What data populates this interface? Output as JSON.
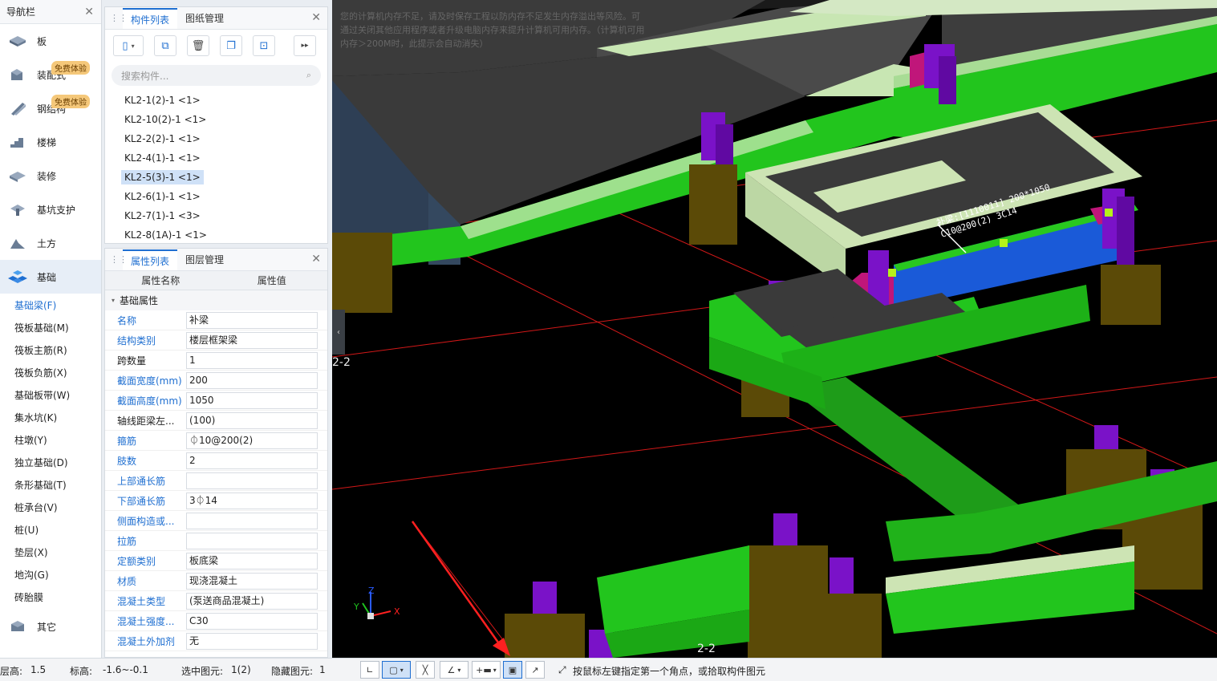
{
  "nav": {
    "title": "导航栏",
    "categories": [
      {
        "label": "板",
        "icon": "slab-icon"
      },
      {
        "label": "装配式",
        "icon": "prefab-icon",
        "badge": "免费体验"
      },
      {
        "label": "钢结构",
        "icon": "steel-structure-icon",
        "badge": "免费体验"
      },
      {
        "label": "楼梯",
        "icon": "stair-icon"
      },
      {
        "label": "装修",
        "icon": "decoration-icon"
      },
      {
        "label": "基坑支护",
        "icon": "pit-support-icon"
      },
      {
        "label": "土方",
        "icon": "earthwork-icon"
      },
      {
        "label": "基础",
        "icon": "foundation-icon"
      }
    ],
    "sub_items": [
      "基础梁(F)",
      "筏板基础(M)",
      "筏板主筋(R)",
      "筏板负筋(X)",
      "基础板带(W)",
      "集水坑(K)",
      "柱墩(Y)",
      "独立基础(D)",
      "条形基础(T)",
      "桩承台(V)",
      "桩(U)",
      "垫层(X)",
      "地沟(G)",
      "砖胎膜"
    ],
    "other": {
      "label": "其它",
      "icon": "other-icon"
    }
  },
  "components": {
    "tabs": [
      "构件列表",
      "图纸管理"
    ],
    "search_placeholder": "搜索构件...",
    "items": [
      "KL2-1(2)-1 <1>",
      "KL2-10(2)-1 <1>",
      "KL2-2(2)-1 <1>",
      "KL2-4(1)-1 <1>",
      "KL2-5(3)-1 <1>",
      "KL2-6(1)-1 <1>",
      "KL2-7(1)-1 <3>",
      "KL2-8(1A)-1 <1>"
    ],
    "selected_index": 4
  },
  "properties": {
    "tabs": [
      "属性列表",
      "图层管理"
    ],
    "col_name": "属性名称",
    "col_value": "属性值",
    "group": "基础属性",
    "rows": [
      {
        "name": "名称",
        "value": "补梁",
        "blue": true
      },
      {
        "name": "结构类别",
        "value": "楼层框架梁",
        "blue": true
      },
      {
        "name": "跨数量",
        "value": "1",
        "blue": false
      },
      {
        "name": "截面宽度(mm)",
        "value": "200",
        "blue": true
      },
      {
        "name": "截面高度(mm)",
        "value": "1050",
        "blue": true
      },
      {
        "name": "轴线距梁左...",
        "value": "(100)",
        "blue": false
      },
      {
        "name": "箍筋",
        "value": "⏀10@200(2)",
        "blue": true
      },
      {
        "name": "肢数",
        "value": "2",
        "blue": true
      },
      {
        "name": "上部通长筋",
        "value": "",
        "blue": true
      },
      {
        "name": "下部通长筋",
        "value": "3⏀14",
        "blue": true
      },
      {
        "name": "侧面构造或...",
        "value": "",
        "blue": true
      },
      {
        "name": "拉筋",
        "value": "",
        "blue": true
      },
      {
        "name": "定额类别",
        "value": "板底梁",
        "blue": true
      },
      {
        "name": "材质",
        "value": "现浇混凝土",
        "blue": true
      },
      {
        "name": "混凝土类型",
        "value": "(泵送商品混凝土)",
        "blue": true
      },
      {
        "name": "混凝土强度...",
        "value": "C30",
        "blue": true
      },
      {
        "name": "混凝土外加剂",
        "value": "无",
        "blue": true
      }
    ]
  },
  "viewport": {
    "warning": "您的计算机内存不足，请及时保存工程以防内存不足发生内存溢出等风险。可通过关闭其他应用程序或者升级电脑内存来提升计算机可用内存。（计算机可用内存＞200M时，此提示会自动消失）",
    "beam_label_1": "补梁:[1110011] 200*1050",
    "beam_label_2": "C10@200(2) 3C14",
    "axis_label": "2-2",
    "axis_x": "X",
    "axis_y": "Y",
    "axis_z": "Z"
  },
  "status": {
    "floor_label": "层高:",
    "floor_value": "1.5",
    "elev_label": "标高:",
    "elev_value": "-1.6~-0.1",
    "selected_label": "选中图元:",
    "selected_value": "1(2)",
    "hidden_label": "隐藏图元:",
    "hidden_value": "1",
    "hint": "按鼠标左键指定第一个角点，或拾取构件图元"
  }
}
